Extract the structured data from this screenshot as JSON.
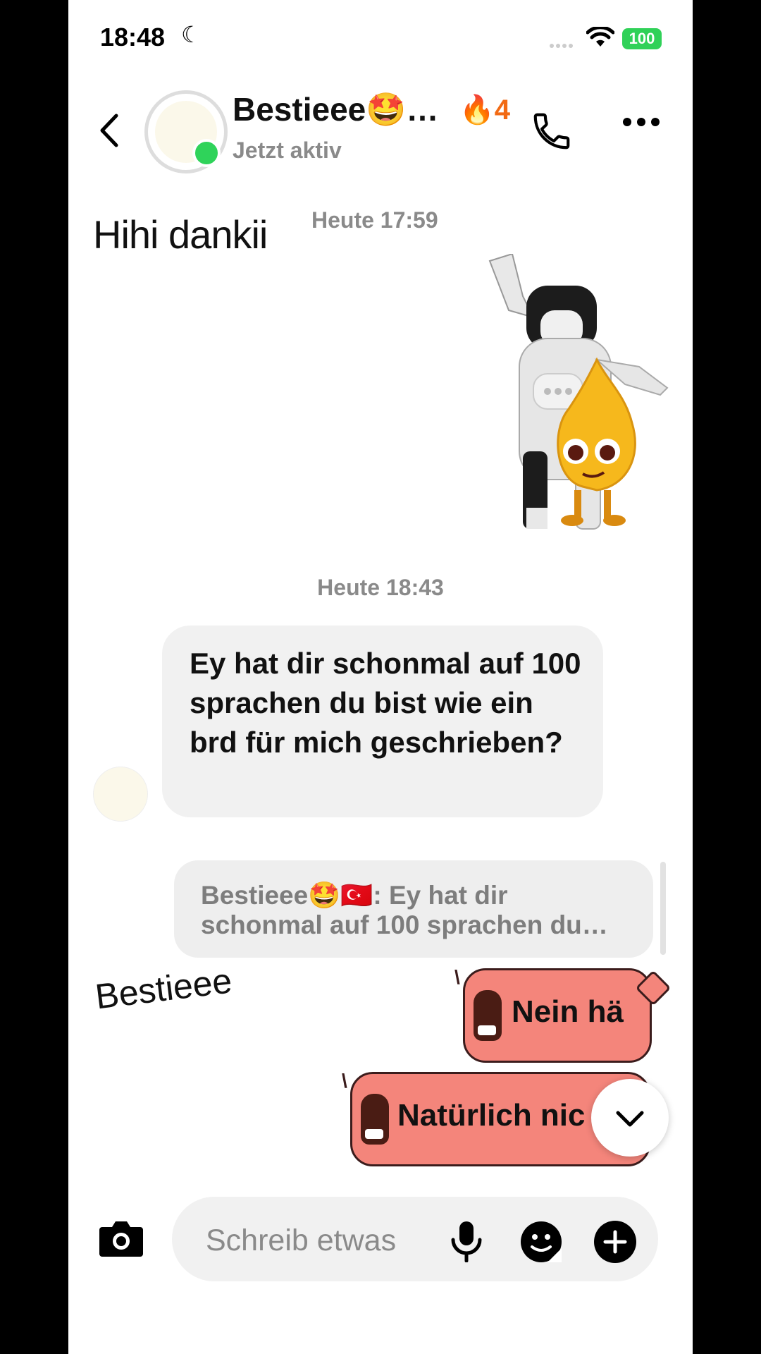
{
  "status_bar": {
    "time": "18:48",
    "moon": "☾",
    "battery": "100"
  },
  "header": {
    "name": "Bestieee🤩…",
    "streak": "🔥4",
    "status": "Jetzt aktiv"
  },
  "chat": {
    "overlay_text": "Hihi dankii",
    "timestamp_1": "Heute 17:59",
    "timestamp_2": "Heute 18:43",
    "incoming_message": "Ey hat dir schonmal auf 100 sprachen du bist wie ein brd für mich geschrieben?",
    "reply_preview": "Bestieee🤩🇹🇷: Ey hat dir schonmal auf 100 sprachen du…",
    "handwritten_label": "Bestieee",
    "outgoing_1": "Nein hä",
    "outgoing_2": "Natürlich nic"
  },
  "composer": {
    "placeholder": "Schreib etwas"
  },
  "colors": {
    "bubble_out": "#f4857b",
    "online": "#2fd35a",
    "streak": "#f26a14"
  }
}
